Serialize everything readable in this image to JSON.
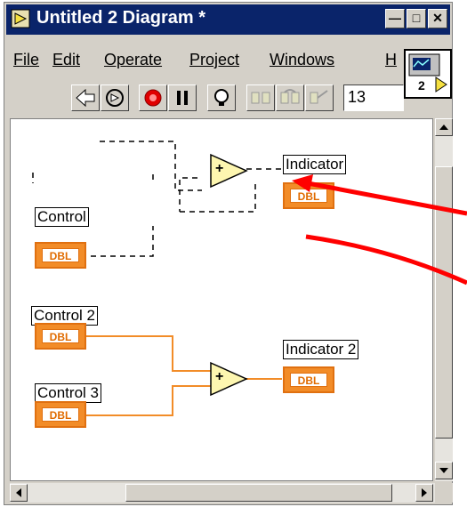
{
  "window": {
    "title": "Untitled 2 Diagram *"
  },
  "menu": [
    "File",
    "Edit",
    "Operate",
    "Project",
    "Windows",
    "H"
  ],
  "toolbar": {
    "font_size_value": "13"
  },
  "vi_icon": {
    "number": "2"
  },
  "diagram": {
    "control_label": "Control",
    "indicator_label": "Indicator",
    "control2_label": "Control 2",
    "control3_label": "Control 3",
    "indicator2_label": "Indicator 2",
    "terminal_type": "DBL",
    "add_symbol": "+"
  },
  "colors": {
    "wire": "#f28c28",
    "title_bar": "#0a246a",
    "arrow": "#ff0000"
  },
  "icons": [
    "run-arrow-icon",
    "run-continuous-icon",
    "abort-icon",
    "pause-icon",
    "highlight-execution-icon",
    "step-into-icon",
    "step-over-icon",
    "step-out-icon"
  ]
}
